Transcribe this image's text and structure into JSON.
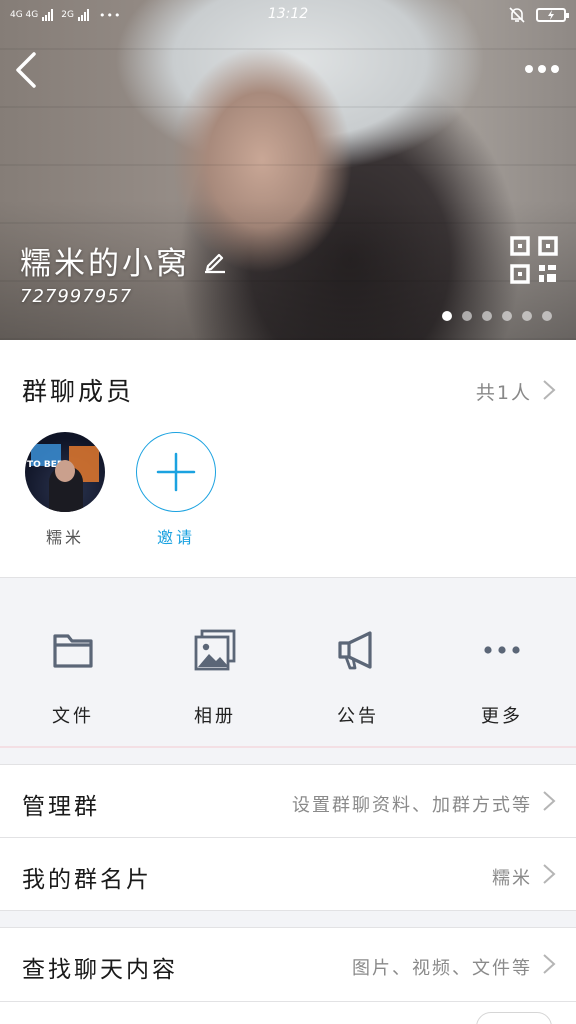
{
  "status_bar": {
    "network_left": "4G 4G",
    "network_right": "2G",
    "time": "13:12"
  },
  "header": {
    "group_name": "糯米的小窝",
    "group_id": "727997957",
    "carousel_pages": 6,
    "carousel_active_index": 0
  },
  "members": {
    "title": "群聊成员",
    "count": "共1人",
    "list": [
      {
        "name": "糯米",
        "avatar_text": "TO BED"
      }
    ],
    "invite_label": "邀请"
  },
  "features": [
    {
      "label": "文件",
      "icon": "folder-icon"
    },
    {
      "label": "相册",
      "icon": "album-icon"
    },
    {
      "label": "公告",
      "icon": "megaphone-icon"
    },
    {
      "label": "更多",
      "icon": "more-dots-icon"
    }
  ],
  "rows": {
    "manage": {
      "label": "管理群",
      "value": "设置群聊资料、加群方式等"
    },
    "card": {
      "label": "我的群名片",
      "value": "糯米"
    },
    "search": {
      "label": "查找聊天内容",
      "value": "图片、视频、文件等"
    }
  },
  "colors": {
    "accent": "#1ba2e0",
    "icon_gray": "#5b6677",
    "bg_gray": "#f3f4f7"
  }
}
